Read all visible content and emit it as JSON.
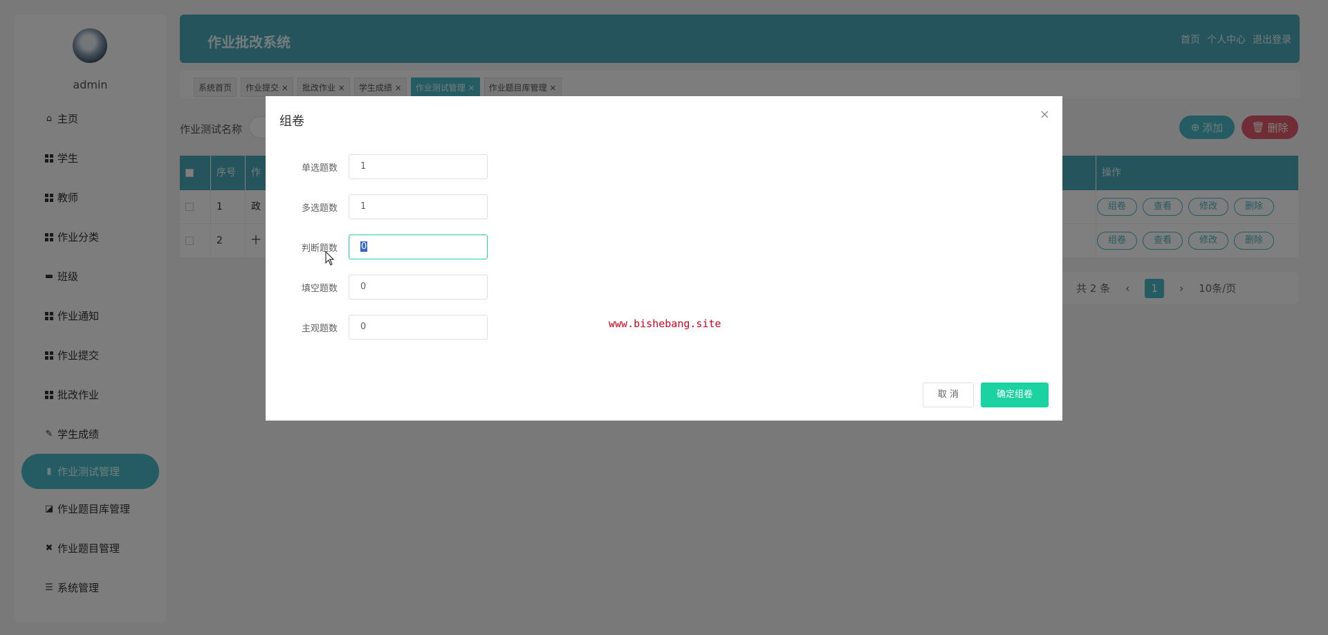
{
  "sidebar": {
    "user": "admin",
    "items": [
      {
        "label": "主页",
        "icon": "home-icon"
      },
      {
        "label": "学生",
        "icon": "grid-icon"
      },
      {
        "label": "教师",
        "icon": "grid-icon"
      },
      {
        "label": "作业分类",
        "icon": "grid-icon"
      },
      {
        "label": "班级",
        "icon": "briefcase-icon"
      },
      {
        "label": "作业通知",
        "icon": "grid-icon"
      },
      {
        "label": "作业提交",
        "icon": "grid-icon"
      },
      {
        "label": "批改作业",
        "icon": "grid-icon"
      },
      {
        "label": "学生成绩",
        "icon": "thumb-icon"
      },
      {
        "label": "作业测试管理",
        "icon": "clipboard-icon"
      },
      {
        "label": "作业题目库管理",
        "icon": "chart-icon"
      },
      {
        "label": "作业题目管理",
        "icon": "ticket-icon"
      },
      {
        "label": "系统管理",
        "icon": "list-icon"
      }
    ]
  },
  "header": {
    "title": "作业批改系统",
    "links": [
      "首页",
      "个人中心",
      "退出登录"
    ]
  },
  "tabs": [
    "系统首页",
    "作业提交",
    "批改作业",
    "学生成绩",
    "作业测试管理",
    "作业题目库管理"
  ],
  "search": {
    "label": "作业测试名称"
  },
  "actions": {
    "add": "添加",
    "delete": "删除"
  },
  "table": {
    "headers": [
      "",
      "序号",
      "作",
      "操作"
    ],
    "rows": [
      {
        "index": "1",
        "name": "政"
      },
      {
        "index": "2",
        "name": "十"
      }
    ],
    "ops": [
      "组卷",
      "查看",
      "修改",
      "删除"
    ]
  },
  "pagination": {
    "total": "共 2 条",
    "current": "1",
    "page_size": "10条/页"
  },
  "modal": {
    "title": "组卷",
    "close": "×",
    "fields": [
      {
        "label": "单选题数",
        "value": "1"
      },
      {
        "label": "多选题数",
        "value": "1"
      },
      {
        "label": "判断题数",
        "value": "0"
      },
      {
        "label": "填空题数",
        "value": "0"
      },
      {
        "label": "主观题数",
        "value": "0"
      }
    ],
    "watermark": "www.bishebang.site",
    "cancel": "取 消",
    "confirm": "确定组卷"
  }
}
